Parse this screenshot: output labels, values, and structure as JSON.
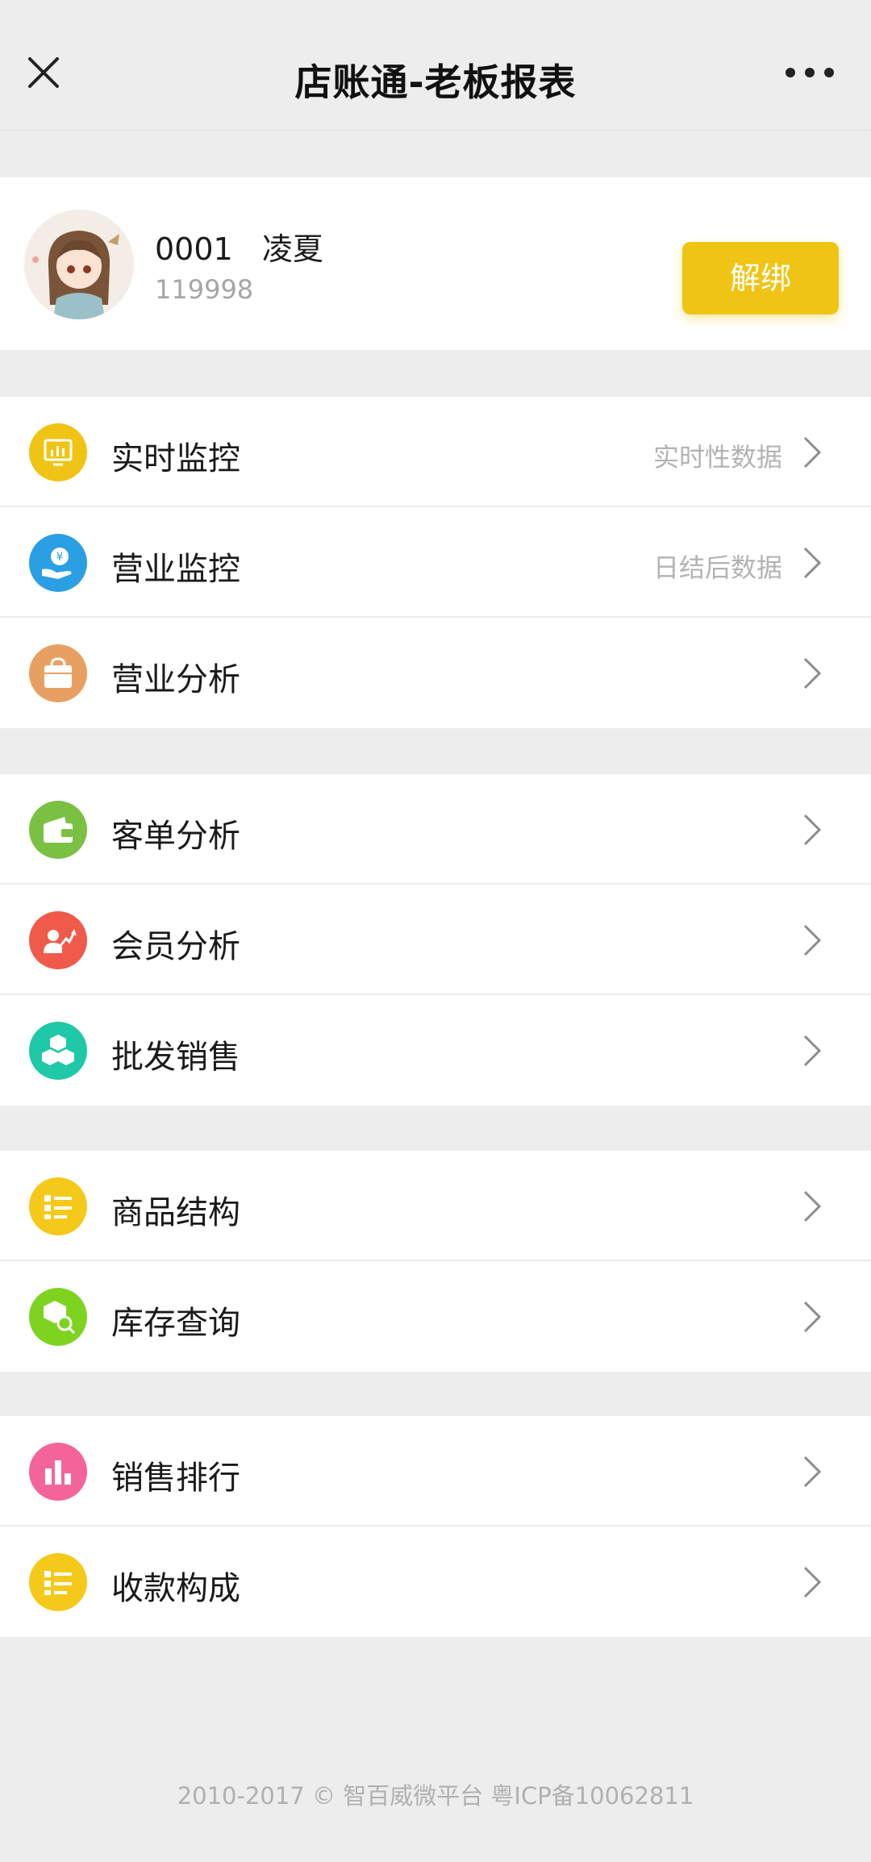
{
  "header": {
    "title": "店账通-老板报表"
  },
  "profile": {
    "name": "0001   凌夏",
    "id": "119998",
    "unbind_label": "解绑"
  },
  "groups": [
    [
      {
        "label": "实时监控",
        "hint": "实时性数据",
        "icon": "monitor-icon",
        "color": "#f0c414"
      },
      {
        "label": "营业监控",
        "hint": "日结后数据",
        "icon": "yen-hand-icon",
        "color": "#2b9fe3"
      },
      {
        "label": "营业分析",
        "hint": "",
        "icon": "shopping-bag-icon",
        "color": "#e8a062"
      }
    ],
    [
      {
        "label": "客单分析",
        "hint": "",
        "icon": "wallet-icon",
        "color": "#7ac143"
      },
      {
        "label": "会员分析",
        "hint": "",
        "icon": "member-growth-icon",
        "color": "#f05a4a"
      },
      {
        "label": "批发销售",
        "hint": "",
        "icon": "boxes-icon",
        "color": "#1fc8a6"
      }
    ],
    [
      {
        "label": "商品结构",
        "hint": "",
        "icon": "list-icon",
        "color": "#f5c91a"
      },
      {
        "label": "库存查询",
        "hint": "",
        "icon": "box-search-icon",
        "color": "#7ed321"
      }
    ],
    [
      {
        "label": "销售排行",
        "hint": "",
        "icon": "bar-chart-icon",
        "color": "#f3659a"
      },
      {
        "label": "收款构成",
        "hint": "",
        "icon": "list-icon",
        "color": "#f5c91a"
      }
    ]
  ],
  "footer": {
    "text": "2010-2017 © 智百威微平台 粤ICP备10062811"
  }
}
